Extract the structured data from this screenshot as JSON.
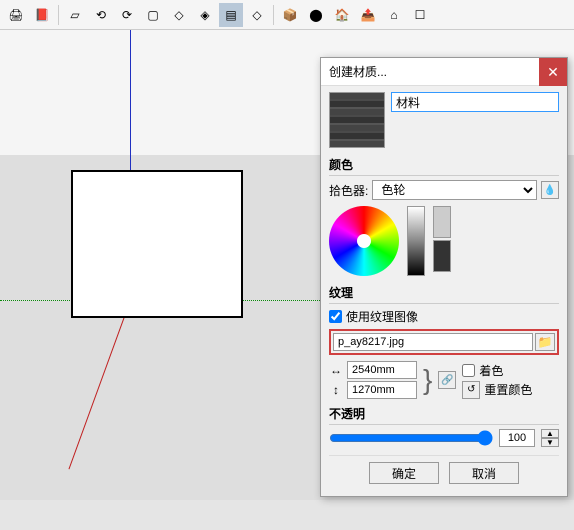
{
  "toolbar": {
    "icons": [
      "printer",
      "help",
      "doc",
      "undo",
      "redo",
      "app",
      "preset1",
      "preset2",
      "layer",
      "preset3",
      "box",
      "cylinder",
      "house",
      "open-box",
      "home",
      "crate"
    ]
  },
  "viewport": {},
  "dialog": {
    "title": "创建材质...",
    "name_value": "材料",
    "sections": {
      "color": "颜色",
      "picker_label": "拾色器:",
      "picker_value": "色轮",
      "texture": "纹理",
      "use_texture": "使用纹理图像",
      "texture_file": "p_ay8217.jpg",
      "width_value": "2540mm",
      "height_value": "1270mm",
      "colorize": "着色",
      "reset_color": "重置颜色",
      "opacity": "不透明",
      "opacity_value": "100"
    },
    "buttons": {
      "ok": "确定",
      "cancel": "取消"
    }
  }
}
